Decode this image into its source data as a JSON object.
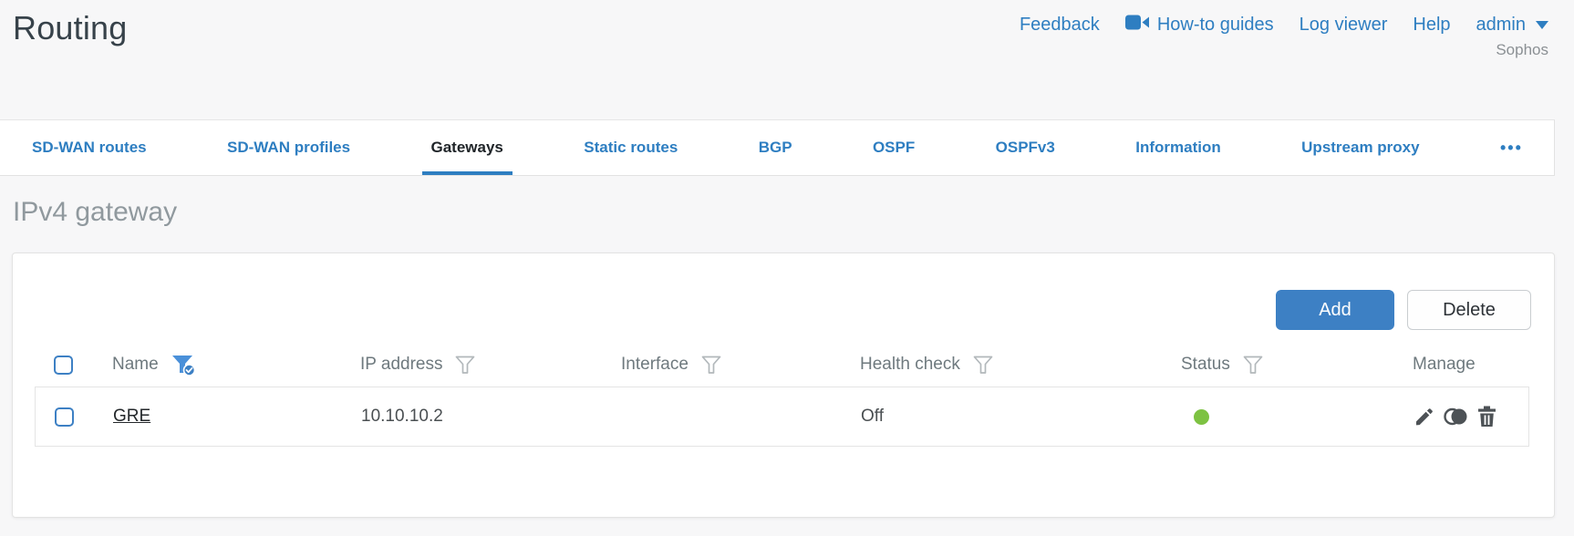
{
  "page": {
    "title": "Routing"
  },
  "header": {
    "links": [
      {
        "label": "Feedback"
      },
      {
        "label": "How-to guides",
        "icon": "video-camera-icon"
      },
      {
        "label": "Log viewer"
      },
      {
        "label": "Help"
      }
    ],
    "user_menu": {
      "label": "admin",
      "icon": "caret-down-icon"
    },
    "brand": "Sophos"
  },
  "tabs": {
    "items": [
      {
        "label": "SD-WAN routes",
        "active": false
      },
      {
        "label": "SD-WAN profiles",
        "active": false
      },
      {
        "label": "Gateways",
        "active": true
      },
      {
        "label": "Static routes",
        "active": false
      },
      {
        "label": "BGP",
        "active": false
      },
      {
        "label": "OSPF",
        "active": false
      },
      {
        "label": "OSPFv3",
        "active": false
      },
      {
        "label": "Information",
        "active": false
      },
      {
        "label": "Upstream proxy",
        "active": false
      }
    ],
    "more_label": "•••"
  },
  "section": {
    "title": "IPv4 gateway"
  },
  "toolbar": {
    "add_label": "Add",
    "delete_label": "Delete"
  },
  "table": {
    "columns": [
      {
        "label": "Name",
        "filter": "active"
      },
      {
        "label": "IP address",
        "filter": "inactive"
      },
      {
        "label": "Interface",
        "filter": "inactive"
      },
      {
        "label": "Health check",
        "filter": "inactive"
      },
      {
        "label": "Status",
        "filter": "inactive"
      },
      {
        "label": "Manage",
        "filter": "none"
      }
    ],
    "rows": [
      {
        "name": "GRE",
        "ip_address": "10.10.10.2",
        "interface": "",
        "health_check": "Off",
        "status": "up",
        "status_style": "background:#7dc242"
      }
    ]
  },
  "icons": {
    "how_to_guides": "video-camera-icon",
    "user_menu": "caret-down-icon",
    "column_filter": "funnel-icon",
    "column_filter_active": "funnel-check-icon",
    "row_edit": "pencil-icon",
    "row_clone": "clone-icon",
    "row_delete": "trash-icon",
    "status_up": "green-dot",
    "more_tabs": "ellipsis"
  },
  "colors": {
    "accent_blue": "#2e7ec1",
    "button_blue": "#3d80c4",
    "status_green": "#7dc242",
    "active_filter_blue": "#4a90d9",
    "background_gray": "#f7f7f8"
  }
}
